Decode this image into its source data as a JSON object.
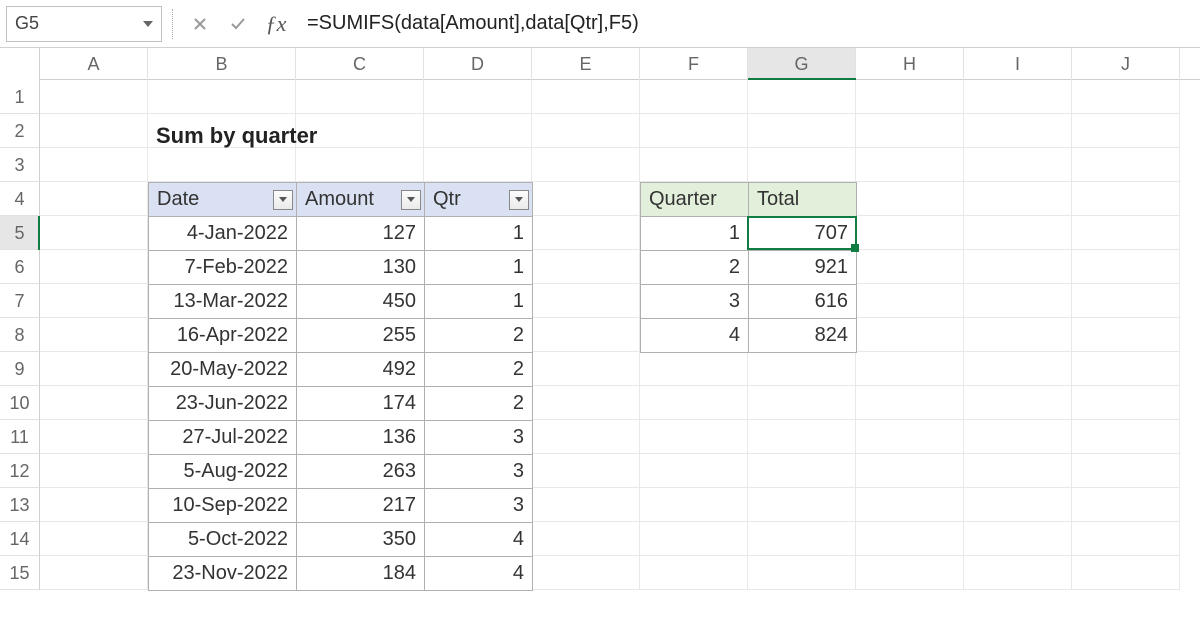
{
  "name_box": "G5",
  "formula": "=SUMIFS(data[Amount],data[Qtr],F5)",
  "title": "Sum by quarter",
  "columns": [
    "A",
    "B",
    "C",
    "D",
    "E",
    "F",
    "G",
    "H",
    "I",
    "J"
  ],
  "active_col": "G",
  "rows": [
    "1",
    "2",
    "3",
    "4",
    "5",
    "6",
    "7",
    "8",
    "9",
    "10",
    "11",
    "12",
    "13",
    "14",
    "15"
  ],
  "active_row": "5",
  "data_table": {
    "headers": [
      "Date",
      "Amount",
      "Qtr"
    ],
    "rows": [
      {
        "date": "4-Jan-2022",
        "amount": "127",
        "qtr": "1"
      },
      {
        "date": "7-Feb-2022",
        "amount": "130",
        "qtr": "1"
      },
      {
        "date": "13-Mar-2022",
        "amount": "450",
        "qtr": "1"
      },
      {
        "date": "16-Apr-2022",
        "amount": "255",
        "qtr": "2"
      },
      {
        "date": "20-May-2022",
        "amount": "492",
        "qtr": "2"
      },
      {
        "date": "23-Jun-2022",
        "amount": "174",
        "qtr": "2"
      },
      {
        "date": "27-Jul-2022",
        "amount": "136",
        "qtr": "3"
      },
      {
        "date": "5-Aug-2022",
        "amount": "263",
        "qtr": "3"
      },
      {
        "date": "10-Sep-2022",
        "amount": "217",
        "qtr": "3"
      },
      {
        "date": "5-Oct-2022",
        "amount": "350",
        "qtr": "4"
      },
      {
        "date": "23-Nov-2022",
        "amount": "184",
        "qtr": "4"
      }
    ]
  },
  "summary_table": {
    "headers": [
      "Quarter",
      "Total"
    ],
    "rows": [
      {
        "q": "1",
        "total": "707"
      },
      {
        "q": "2",
        "total": "921"
      },
      {
        "q": "3",
        "total": "616"
      },
      {
        "q": "4",
        "total": "824"
      }
    ]
  }
}
